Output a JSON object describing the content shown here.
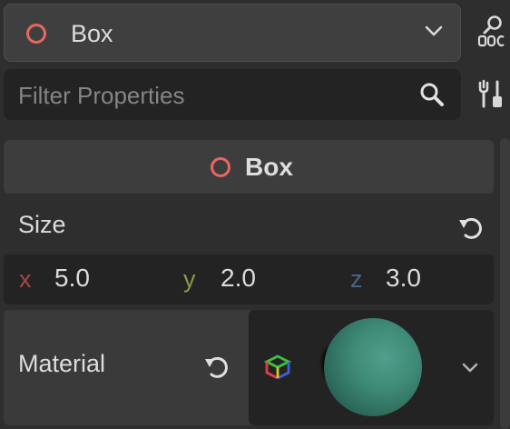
{
  "node_selector": {
    "label": "Box",
    "icon": "circle-outline-icon",
    "accent": "#e8675f"
  },
  "top_right": {
    "doc_icon": "doc-icon",
    "tools_icon": "tools-icon"
  },
  "filter": {
    "placeholder": "Filter Properties",
    "value": "",
    "icon": "search-icon"
  },
  "section": {
    "title": "Box",
    "icon": "circle-outline-icon"
  },
  "size": {
    "label": "Size",
    "x_axis": "x",
    "x": "5.0",
    "y_axis": "y",
    "y": "2.0",
    "z_axis": "z",
    "z": "3.0",
    "axis_colors": {
      "x": "#a04848",
      "y": "#8a9a4c",
      "z": "#4a6488"
    }
  },
  "material": {
    "label": "Material",
    "preview_color": "#3e8a76"
  }
}
